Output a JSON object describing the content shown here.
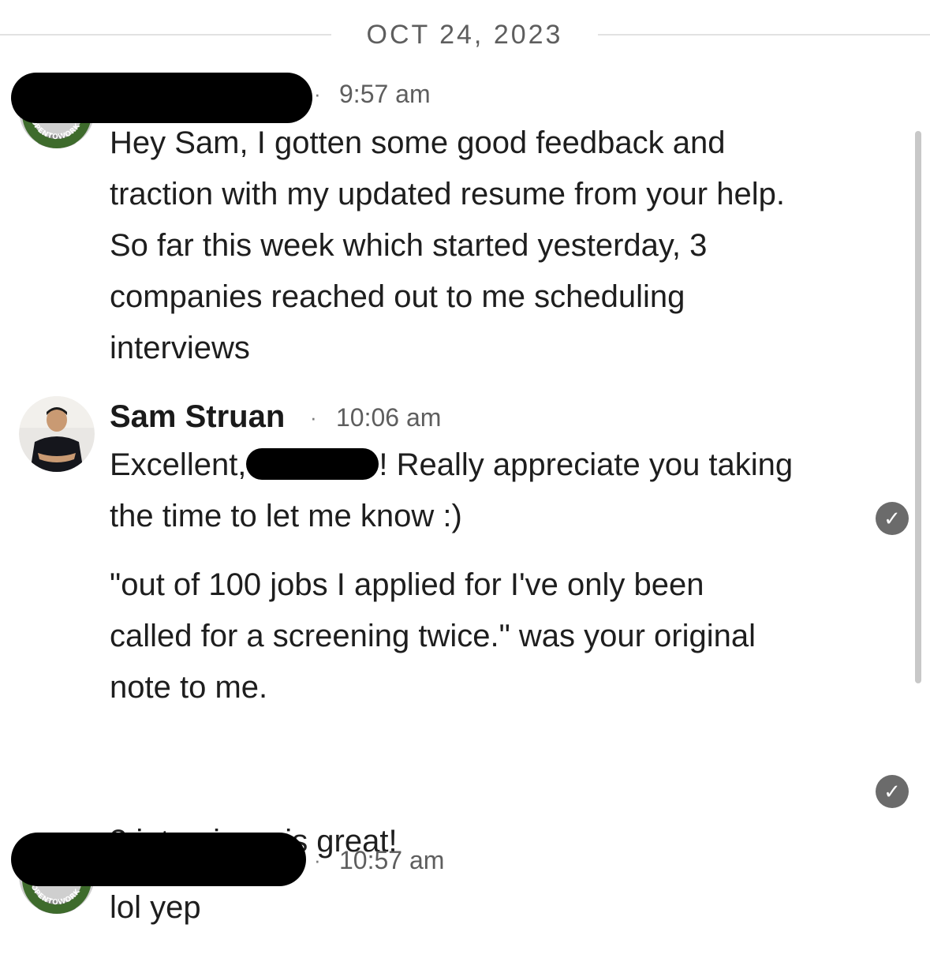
{
  "date_separator": "OCT 24, 2023",
  "messages": [
    {
      "sender_visible": false,
      "time": "9:57 am",
      "text": "Hey Sam, I gotten some good feedback and\ntraction with my updated resume from your help.\nSo far this week which started yesterday, 3\ncompanies reached out to me scheduling\ninterviews"
    },
    {
      "sender": "Sam Struan",
      "time": "10:06 am",
      "text_before": "Excellent,",
      "text_after": "! Really appreciate you taking\nthe time to let me know :)",
      "text2": "\"out of 100 jobs I applied for I've only been\ncalled for a screening twice.\" was your original\nnote to me.\n\n\n3 interviews is great!"
    },
    {
      "sender_visible": false,
      "time": "10:57 am",
      "text": "lol yep"
    }
  ],
  "avatar_badge_text": "OPENTOWORK",
  "icons": {
    "read_receipt": "check-circle-icon"
  },
  "colors": {
    "opentowork_green": "#3e6b2c",
    "read_receipt": "#6b6b6b"
  }
}
